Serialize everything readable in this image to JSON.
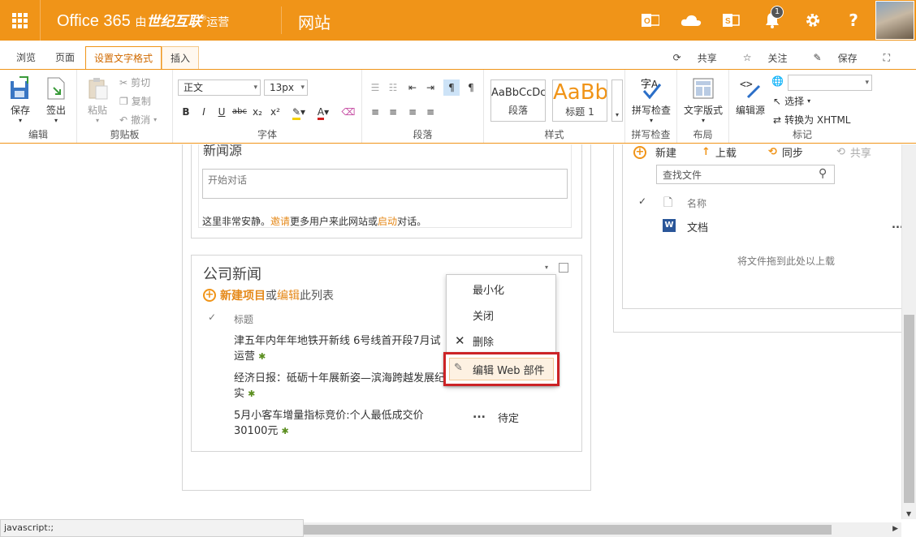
{
  "suite": {
    "brand_prefix": "Office 365",
    "brand_by": "由",
    "brand_partner": "世纪互联",
    "brand_op": "运营",
    "site": "网站",
    "notification_count": "1"
  },
  "tabs": [
    "浏览",
    "页面",
    "设置文字格式",
    "插入"
  ],
  "actions": {
    "share": "共享",
    "follow": "关注",
    "save": "保存"
  },
  "ribbon": {
    "edit": {
      "save": "保存",
      "checkout": "签出",
      "label": "编辑"
    },
    "clipboard": {
      "paste": "粘贴",
      "cut": "剪切",
      "copy": "复制",
      "undo": "撤消",
      "label": "剪贴板"
    },
    "font": {
      "style": "正文",
      "size": "13px",
      "label": "字体",
      "bold": "B",
      "italic": "I",
      "underline": "U",
      "strike": "abc",
      "sub": "x₂",
      "sup": "x²"
    },
    "paragraph": {
      "label": "段落"
    },
    "styles": {
      "normal_sample": "AaBbCcDc",
      "normal_label": "段落",
      "h1_sample": "AaBb",
      "h1_label": "标题 1",
      "label": "样式"
    },
    "spell": {
      "btn": "拼写检查",
      "label": "拼写检查"
    },
    "layout": {
      "btn": "文字版式",
      "label": "布局"
    },
    "markup": {
      "edit_source": "编辑源",
      "select": "选择",
      "convert": "转换为 XHTML",
      "label": "标记"
    }
  },
  "newsfeed": {
    "title": "新闻源",
    "placeholder": "开始对话",
    "quiet_1": "这里非常安静。",
    "invite": "邀请",
    "quiet_2": "更多用户来此网站或",
    "start": "启动",
    "quiet_3": "对话。"
  },
  "news": {
    "title": "公司新闻",
    "new_item": "新建项目",
    "or": "或",
    "edit": "编辑",
    "this_list": "此列表",
    "col_title": "标题",
    "items": [
      {
        "text": "津五年内年年地铁开新线 6号线首开段7月试运营"
      },
      {
        "text": "经济日报：砥砺十年展新姿—滨海跨越发展纪实"
      },
      {
        "text": "5月小客车增量指标竞价:个人最低成交价30100元",
        "status": "待定"
      }
    ],
    "more": "..."
  },
  "menu": {
    "minimize": "最小化",
    "close": "关闭",
    "delete": "删除",
    "edit_webpart": "编辑 Web 部件"
  },
  "docs": {
    "new": "新建",
    "upload": "上载",
    "sync": "同步",
    "share": "共享",
    "search_placeholder": "查找文件",
    "col_name": "名称",
    "item": "文档",
    "drop_hint": "将文件拖到此处以上载",
    "more": "..."
  },
  "status": "javascript:;"
}
